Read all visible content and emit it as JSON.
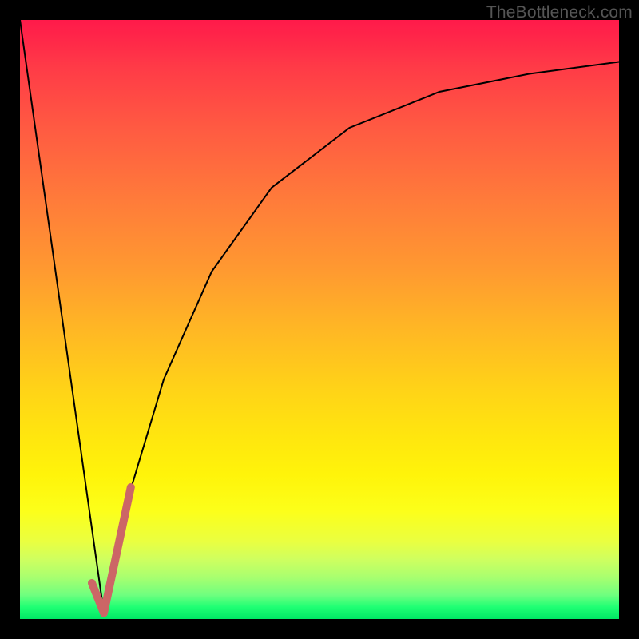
{
  "watermark": "TheBottleneck.com",
  "chart_data": {
    "type": "line",
    "title": "",
    "xlabel": "",
    "ylabel": "",
    "xlim": [
      0,
      100
    ],
    "ylim": [
      0,
      100
    ],
    "background_gradient": {
      "top_color": "#ff1a4a",
      "bottom_color": "#00e865",
      "meaning": "red=high bottleneck, green=low bottleneck"
    },
    "series": [
      {
        "name": "left-branch",
        "x": [
          0,
          14
        ],
        "values": [
          100,
          1
        ],
        "stroke": "#000000",
        "width": 2
      },
      {
        "name": "right-branch",
        "x": [
          14,
          18,
          24,
          32,
          42,
          55,
          70,
          85,
          100
        ],
        "values": [
          1,
          20,
          40,
          58,
          72,
          82,
          88,
          91,
          93
        ],
        "stroke": "#000000",
        "width": 2
      },
      {
        "name": "highlight-notch",
        "x": [
          12,
          14,
          18.5
        ],
        "values": [
          6,
          1,
          22
        ],
        "stroke": "#cc6666",
        "width": 10
      }
    ]
  }
}
